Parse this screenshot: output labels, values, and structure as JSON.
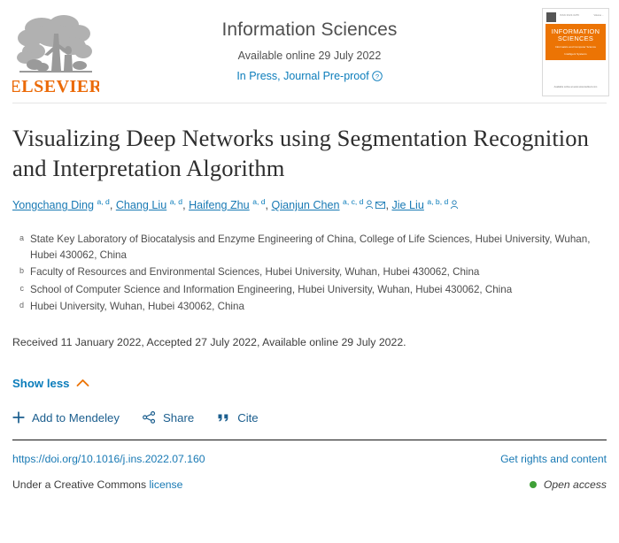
{
  "publisher": {
    "logo_text": "ELSEVIER",
    "logo_color": "#eb6a07"
  },
  "journal": {
    "title": "Information Sciences",
    "available_online": "Available online 29 July 2022",
    "status_label": "In Press, Journal Pre-proof",
    "help_icon": "question-mark-circle-icon",
    "cover": {
      "title_line1": "INFORMATION",
      "title_line2": "SCIENCES",
      "subtitle": "Informatics and Computer Science",
      "subtitle2": "Intelligent Systems",
      "subtitle3": "Applications",
      "tagline": "AN INTERNATIONAL JOURNAL",
      "top_left_text": "ISSN 0020-0255",
      "top_right_text": "Volume ...",
      "bottom_text": "Available online at\nwww.sciencedirect.com",
      "accent_color": "#ec7404"
    }
  },
  "article": {
    "title": "Visualizing Deep Networks using Segmentation Recognition and Interpretation Algorithm",
    "authors": [
      {
        "name": "Yongchang Ding",
        "marks": "a, d",
        "icons": []
      },
      {
        "name": "Chang Liu",
        "marks": "a, d",
        "icons": []
      },
      {
        "name": "Haifeng Zhu",
        "marks": "a, d",
        "icons": []
      },
      {
        "name": "Qianjun Chen",
        "marks": "a, c, d",
        "icons": [
          "person-icon",
          "envelope-icon"
        ]
      },
      {
        "name": "Jie Liu",
        "marks": "a, b, d",
        "icons": [
          "person-icon"
        ]
      }
    ],
    "affiliations": [
      {
        "mark": "a",
        "text": "State Key Laboratory of Biocatalysis and Enzyme Engineering of China, College of Life Sciences, Hubei University, Wuhan, Hubei 430062, China"
      },
      {
        "mark": "b",
        "text": "Faculty of Resources and Environmental Sciences, Hubei University, Wuhan, Hubei 430062, China"
      },
      {
        "mark": "c",
        "text": "School of Computer Science and Information Engineering, Hubei University, Wuhan, Hubei 430062, China"
      },
      {
        "mark": "d",
        "text": "Hubei University, Wuhan, Hubei 430062, China"
      }
    ],
    "dates": "Received 11 January 2022, Accepted 27 July 2022, Available online 29 July 2022."
  },
  "controls": {
    "show_less_label": "Show less",
    "show_less_icon": "chevron-up-icon",
    "chevron_color": "#ec7404",
    "actions": [
      {
        "label": "Add to Mendeley",
        "icon": "plus-icon"
      },
      {
        "label": "Share",
        "icon": "share-nodes-icon"
      },
      {
        "label": "Cite",
        "icon": "quote-icon"
      }
    ]
  },
  "footer": {
    "doi": "https://doi.org/10.1016/j.ins.2022.07.160",
    "rights_label": "Get rights and content",
    "license_prefix": "Under a Creative Commons",
    "license_link": "license",
    "open_access_label": "Open access",
    "open_access_dot_color": "#3fa037"
  },
  "theme": {
    "link_color": "#1879b4",
    "text_color": "#3d3d3d"
  }
}
